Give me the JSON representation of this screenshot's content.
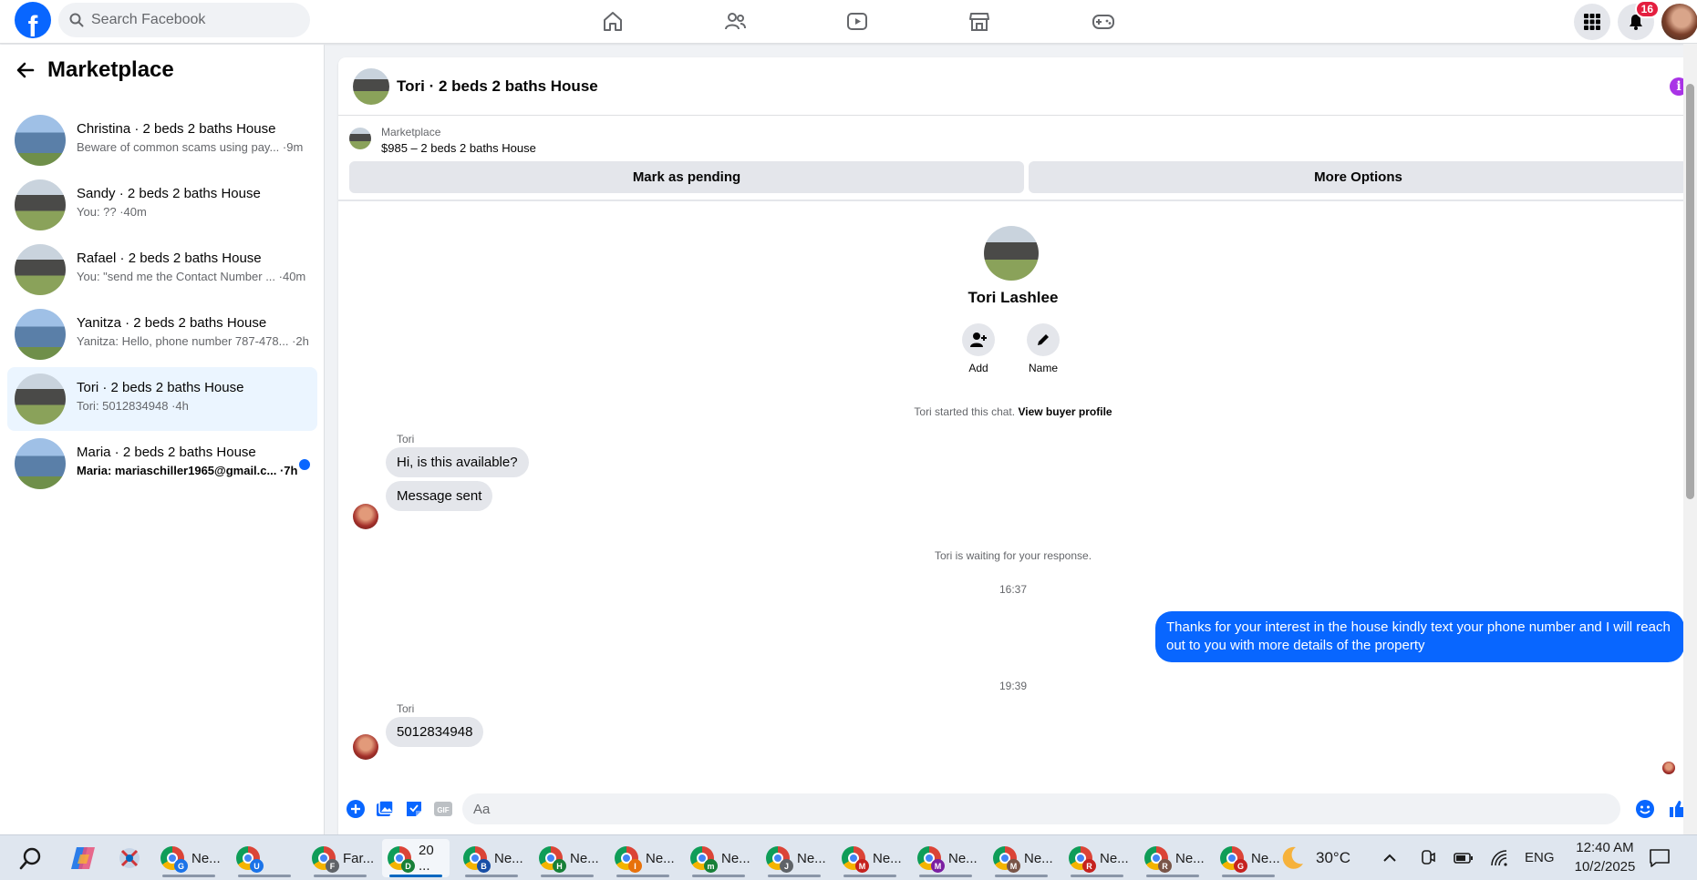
{
  "topbar": {
    "search_placeholder": "Search Facebook",
    "notification_count": "16",
    "nav_icons": [
      "home-icon",
      "friends-icon",
      "video-icon",
      "marketplace-icon",
      "gaming-icon"
    ]
  },
  "sidebar": {
    "title": "Marketplace",
    "conversations": [
      {
        "name": "Christina · 2 beds 2 baths House",
        "preview": "Beware of common scams using pay... ·9m",
        "thumb": "house-blue",
        "unread": false,
        "active": false
      },
      {
        "name": "Sandy · 2 beds 2 baths House",
        "preview": "You: ?? ·40m",
        "thumb": "house-dark",
        "unread": false,
        "active": false
      },
      {
        "name": "Rafael · 2 beds 2 baths House",
        "preview": "You: \"send me the Contact Number ... ·40m",
        "thumb": "house-dark",
        "unread": false,
        "active": false
      },
      {
        "name": "Yanitza · 2 beds 2 baths House",
        "preview": "Yanitza: Hello, phone number 787-478... ·2h",
        "thumb": "house-blue",
        "unread": false,
        "active": false
      },
      {
        "name": "Tori · 2 beds 2 baths House",
        "preview": "Tori: 5012834948 ·4h",
        "thumb": "house-dark",
        "unread": false,
        "active": true
      },
      {
        "name": "Maria · 2 beds 2 baths House",
        "preview": "Maria: mariaschiller1965@gmail.c... ·7h",
        "thumb": "house-blue",
        "unread": true,
        "active": false
      }
    ]
  },
  "chat": {
    "title": "Tori · 2 beds 2 baths House",
    "marketplace_label": "Marketplace",
    "listing": "$985 – 2 beds 2 baths House",
    "mark_pending": "Mark as pending",
    "more_options": "More Options",
    "profile_name": "Tori Lashlee",
    "add_label": "Add",
    "name_label": "Name",
    "started_text": "Tori started this chat.",
    "view_profile": "View buyer profile",
    "sender1": "Tori",
    "msg1": "Hi, is this available?",
    "msg2": "Message sent",
    "waiting": "Tori is waiting for your response.",
    "time1": "16:37",
    "outgoing": "Thanks for your interest in the house kindly text your phone number and I will reach out to you with more details of the property",
    "time2": "19:39",
    "sender2": "Tori",
    "msg3": "5012834948",
    "composer_placeholder": "Aa"
  },
  "taskbar": {
    "items": [
      {
        "label": "Ne...",
        "mark": "G",
        "color": "#1a73e8"
      },
      {
        "label": "",
        "mark": "U",
        "color": "#1a73e8"
      },
      {
        "label": "Far...",
        "mark": "F",
        "color": "#5f6368"
      },
      {
        "label": "20 ...",
        "mark": "D",
        "color": "#188038"
      },
      {
        "label": "Ne...",
        "mark": "B",
        "color": "#174ea6"
      },
      {
        "label": "Ne...",
        "mark": "H",
        "color": "#188038"
      },
      {
        "label": "Ne...",
        "mark": "I",
        "color": "#e8710a"
      },
      {
        "label": "Ne...",
        "mark": "m",
        "color": "#188038"
      },
      {
        "label": "Ne...",
        "mark": "J",
        "color": "#5f6368"
      },
      {
        "label": "Ne...",
        "mark": "M",
        "color": "#c5221f"
      },
      {
        "label": "Ne...",
        "mark": "M",
        "color": "#7b1fa2"
      },
      {
        "label": "Ne...",
        "mark": "M",
        "color": "#795548"
      },
      {
        "label": "Ne...",
        "mark": "R",
        "color": "#c5221f"
      },
      {
        "label": "Ne...",
        "mark": "R",
        "color": "#795548"
      },
      {
        "label": "Ne...",
        "mark": "G",
        "color": "#c5221f"
      }
    ],
    "temperature": "30°C",
    "language": "ENG",
    "time": "12:40 AM",
    "date": "10/2/2025"
  },
  "colors": {
    "brand": "#0866ff",
    "outgoing_bubble": "#0866ff",
    "active_conversation": "#ebf5ff",
    "badge": "#e41e3f"
  }
}
